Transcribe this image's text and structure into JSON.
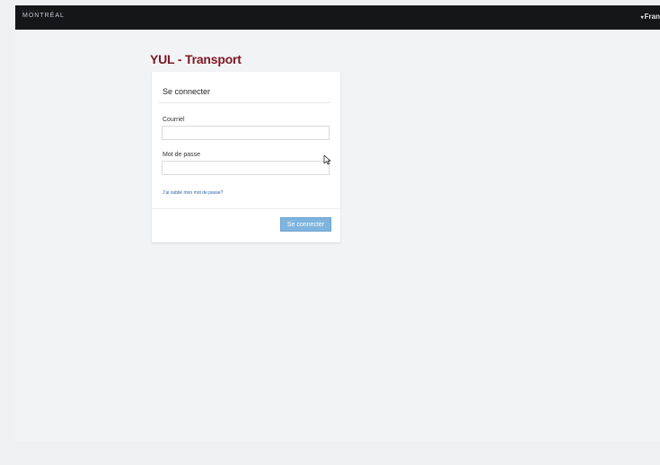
{
  "header": {
    "logo_small": "▪ ▪ ▪ ▪ ▪",
    "logo_text": "MONTRÉAL",
    "language_caret": "▾",
    "language_label": "Fran"
  },
  "page": {
    "title": "YUL - Transport"
  },
  "login": {
    "heading": "Se connecter",
    "email_label": "Courriel",
    "email_value": "",
    "password_label": "Mot de passe",
    "password_value": "",
    "forgot_link": "J'ai oublié mon mot de passe?",
    "submit_label": "Se connecter"
  },
  "icons": {
    "cursor": "mouse-pointer-icon"
  }
}
